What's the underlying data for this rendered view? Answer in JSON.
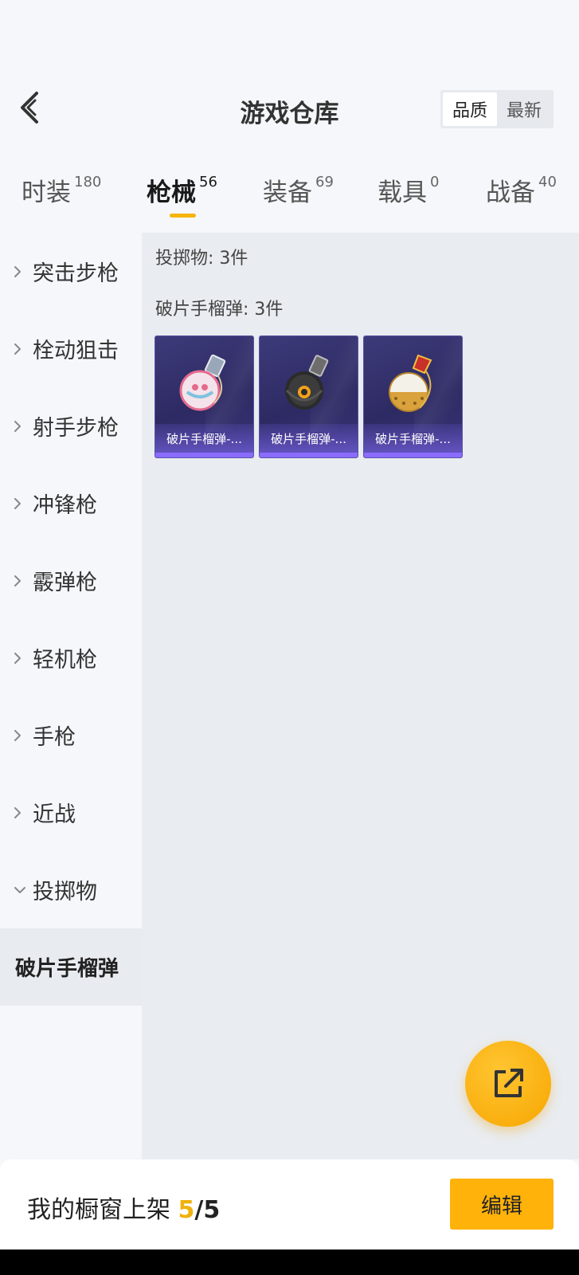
{
  "header": {
    "title": "游戏仓库",
    "sort_options": [
      "品质",
      "最新"
    ],
    "active_sort": 0
  },
  "tabs": [
    {
      "label": "时装",
      "count": "180"
    },
    {
      "label": "枪械",
      "count": "56"
    },
    {
      "label": "装备",
      "count": "69"
    },
    {
      "label": "载具",
      "count": "0"
    },
    {
      "label": "战备",
      "count": "40"
    }
  ],
  "active_tab": 1,
  "sidebar": {
    "items": [
      {
        "label": "突击步枪",
        "expanded": false
      },
      {
        "label": "栓动狙击",
        "expanded": false
      },
      {
        "label": "射手步枪",
        "expanded": false
      },
      {
        "label": "冲锋枪",
        "expanded": false
      },
      {
        "label": "霰弹枪",
        "expanded": false
      },
      {
        "label": "轻机枪",
        "expanded": false
      },
      {
        "label": "手枪",
        "expanded": false
      },
      {
        "label": "近战",
        "expanded": false
      },
      {
        "label": "投掷物",
        "expanded": true
      }
    ],
    "sub_item": "破片手榴弹"
  },
  "content": {
    "category_summary": "投掷物: 3件",
    "sub_summary": "破片手榴弹: 3件",
    "items": [
      {
        "name": "破片手榴弹-...",
        "icon": "pink-grenade-icon",
        "colors": [
          "#f4e3ea",
          "#e46b8e",
          "#7ec2e0"
        ]
      },
      {
        "name": "破片手榴弹-...",
        "icon": "black-grenade-icon",
        "colors": [
          "#2b2b2b",
          "#4a4a4a",
          "#f0a21b"
        ]
      },
      {
        "name": "破片手榴弹-...",
        "icon": "gold-grenade-icon",
        "colors": [
          "#f4f1e8",
          "#d9a23c",
          "#c8302a"
        ]
      }
    ]
  },
  "bottom": {
    "showcase_label": "我的橱窗上架",
    "showcase_current": "5",
    "showcase_sep": "/",
    "showcase_total": "5",
    "edit_label": "编辑"
  },
  "colors": {
    "accent": "#f5b50f",
    "card_bg": "#2d2a63",
    "card_border": "#5a52a8"
  }
}
